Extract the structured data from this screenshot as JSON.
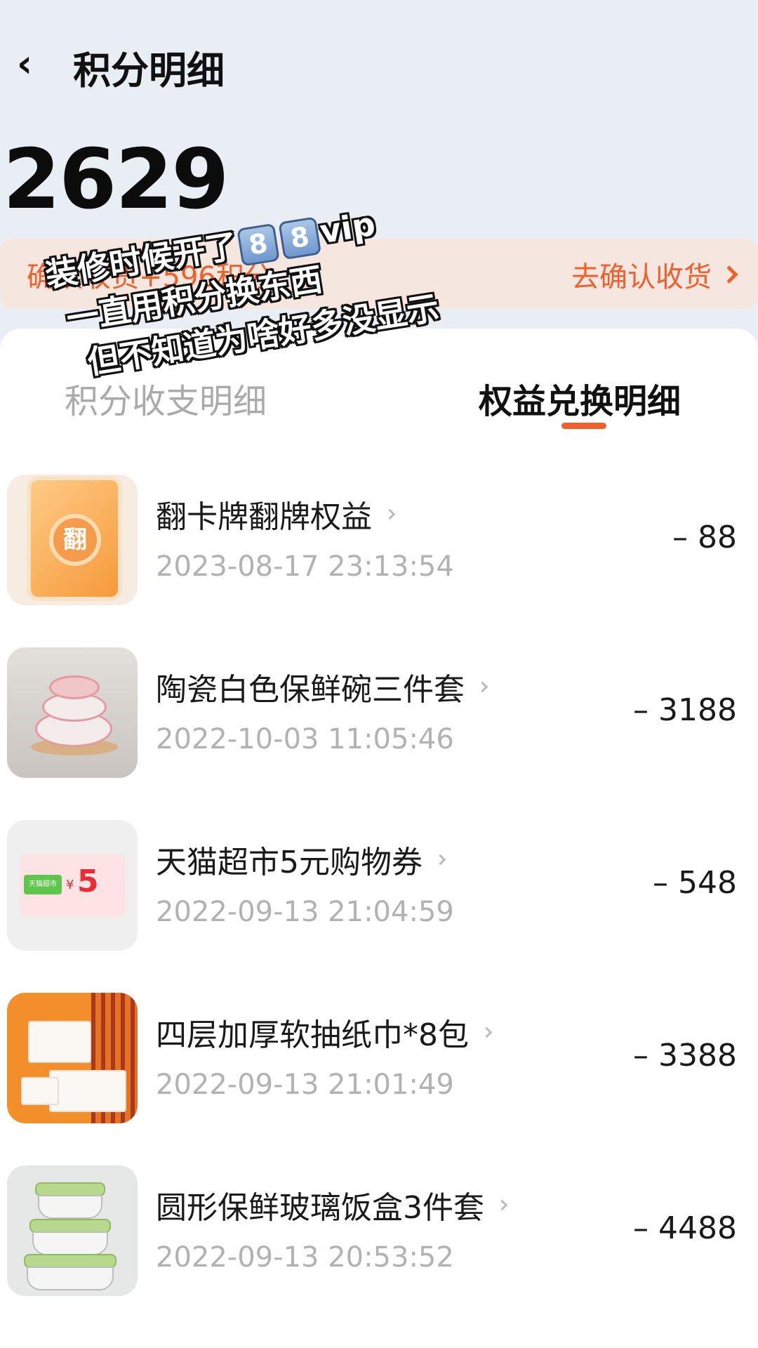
{
  "header": {
    "back_icon": "chevron-left-icon",
    "title": "积分明细"
  },
  "points": {
    "total": "2629"
  },
  "notice": {
    "text": "确认收货+596积分",
    "action": "去确认收货",
    "action_icon": "chevron-right-icon"
  },
  "tabs": [
    {
      "label": "积分收支明细",
      "active": false
    },
    {
      "label": "权益兑换明细",
      "active": true
    }
  ],
  "overlay_text": {
    "line1_prefix": "装修时候开了",
    "key1": "8",
    "key2": "8",
    "line1_suffix": "vip",
    "line2": "一直用积分换东西",
    "line3": "但不知道为啥好多没显示"
  },
  "colors": {
    "accent": "#f0602c",
    "top_background": "#e9eef5",
    "notice_background": "#f5e7e0"
  },
  "items": [
    {
      "name": "翻卡牌翻牌权益",
      "time": "2023-08-17 23:13:54",
      "points": "– 88",
      "thumb_text": "翻"
    },
    {
      "name": "陶瓷白色保鲜碗三件套",
      "time": "2022-10-03 11:05:46",
      "points": "– 3188"
    },
    {
      "name": "天猫超市5元购物券",
      "time": "2022-09-13 21:04:59",
      "points": "– 548",
      "thumb_tag": "天猫超市",
      "thumb_yen": "¥",
      "thumb_value": "5"
    },
    {
      "name": "四层加厚软抽纸巾*8包",
      "time": "2022-09-13 21:01:49",
      "points": "– 3388"
    },
    {
      "name": "圆形保鲜玻璃饭盒3件套",
      "time": "2022-09-13 20:53:52",
      "points": "– 4488"
    }
  ]
}
